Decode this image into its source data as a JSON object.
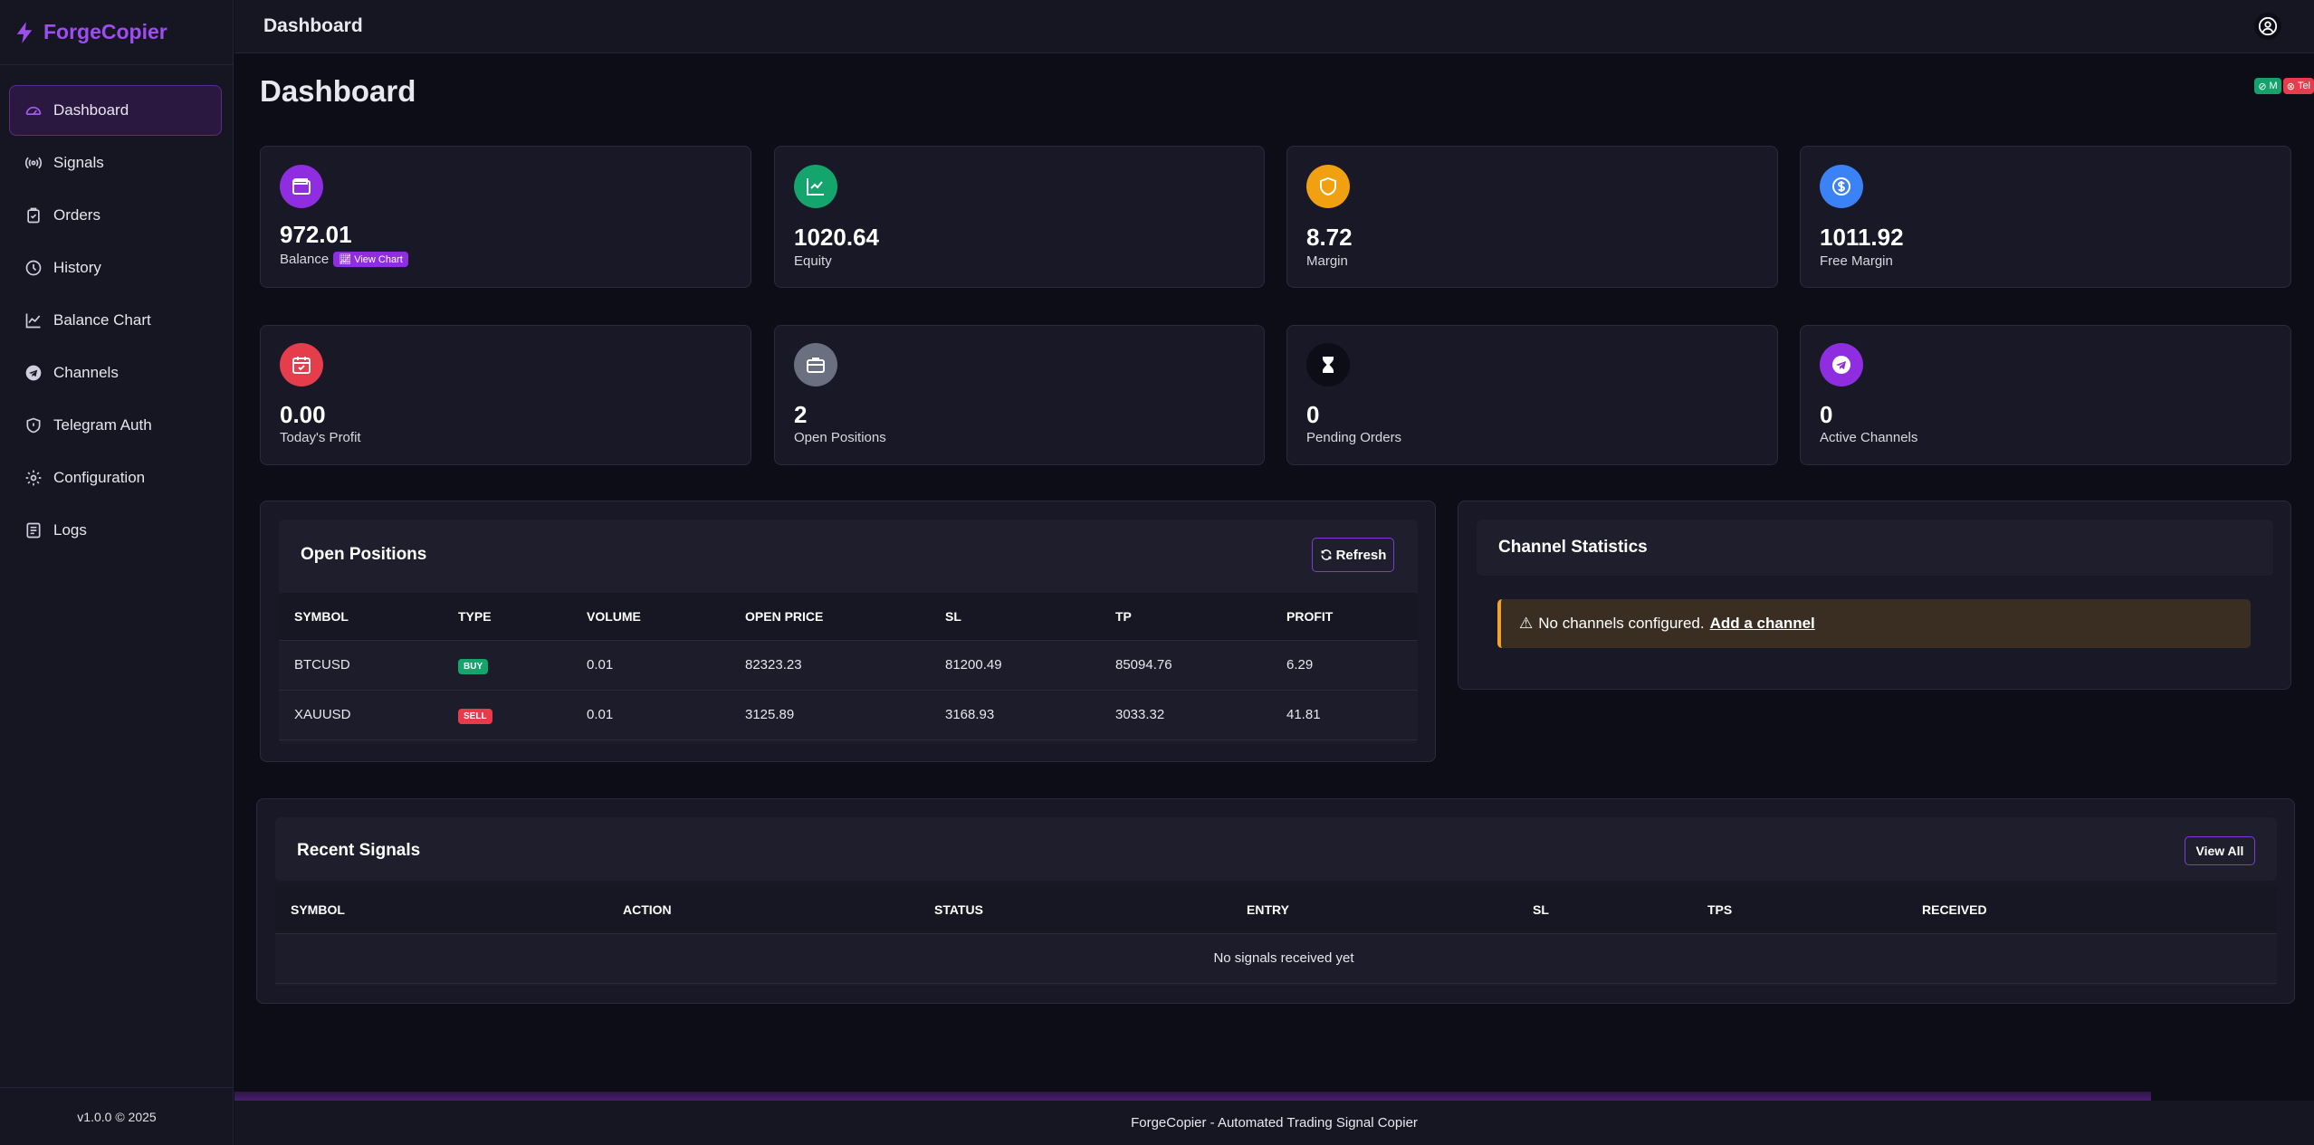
{
  "app": {
    "name": "ForgeCopier",
    "version": "v1.0.0 © 2025",
    "footer": "ForgeCopier - Automated Trading Signal Copier"
  },
  "sidebar": {
    "items": [
      {
        "label": "Dashboard",
        "icon": "dashboard-gauge-icon"
      },
      {
        "label": "Signals",
        "icon": "broadcast-icon"
      },
      {
        "label": "Orders",
        "icon": "clipboard-icon"
      },
      {
        "label": "History",
        "icon": "clock-icon"
      },
      {
        "label": "Balance Chart",
        "icon": "line-chart-icon"
      },
      {
        "label": "Channels",
        "icon": "telegram-icon"
      },
      {
        "label": "Telegram Auth",
        "icon": "shield-icon"
      },
      {
        "label": "Configuration",
        "icon": "gear-icon"
      },
      {
        "label": "Logs",
        "icon": "log-list-icon"
      }
    ]
  },
  "header": {
    "title": "Dashboard"
  },
  "page": {
    "title": "Dashboard"
  },
  "status": {
    "mt_label": "M",
    "telegram_label": "Tel",
    "mt_color": "#13a26b",
    "telegram_color": "#e53d4b"
  },
  "stats": [
    {
      "value": "972.01",
      "label": "Balance",
      "extra": "View Chart",
      "color": "#8f2de0",
      "icon": "wallet-icon"
    },
    {
      "value": "1020.64",
      "label": "Equity",
      "color": "#14a56d",
      "icon": "trend-up-icon"
    },
    {
      "value": "8.72",
      "label": "Margin",
      "color": "#f0a010",
      "icon": "shield-icon"
    },
    {
      "value": "1011.92",
      "label": "Free Margin",
      "color": "#3b82f6",
      "icon": "dollar-icon"
    },
    {
      "value": "0.00",
      "label": "Today's Profit",
      "color": "#e53d4b",
      "icon": "calendar-check-icon"
    },
    {
      "value": "2",
      "label": "Open Positions",
      "color": "#6b7080",
      "icon": "briefcase-icon"
    },
    {
      "value": "0",
      "label": "Pending Orders",
      "color": "#0d0d18",
      "icon": "hourglass-icon"
    },
    {
      "value": "0",
      "label": "Active Channels",
      "color": "#8f2de0",
      "icon": "telegram-icon"
    }
  ],
  "positions": {
    "title": "Open Positions",
    "refresh_label": "Refresh",
    "columns": [
      "SYMBOL",
      "TYPE",
      "VOLUME",
      "OPEN PRICE",
      "SL",
      "TP",
      "PROFIT"
    ],
    "rows": [
      {
        "symbol": "BTCUSD",
        "type": "BUY",
        "volume": "0.01",
        "open_price": "82323.23",
        "sl": "81200.49",
        "tp": "85094.76",
        "profit": "6.29"
      },
      {
        "symbol": "XAUUSD",
        "type": "SELL",
        "volume": "0.01",
        "open_price": "3125.89",
        "sl": "3168.93",
        "tp": "3033.32",
        "profit": "41.81"
      }
    ]
  },
  "channels": {
    "title": "Channel Statistics",
    "alert_text": "No channels configured.",
    "alert_link": "Add a channel"
  },
  "signals": {
    "title": "Recent Signals",
    "view_all_label": "View All",
    "columns": [
      "SYMBOL",
      "ACTION",
      "STATUS",
      "ENTRY",
      "SL",
      "TPS",
      "RECEIVED"
    ],
    "empty": "No signals received yet"
  }
}
